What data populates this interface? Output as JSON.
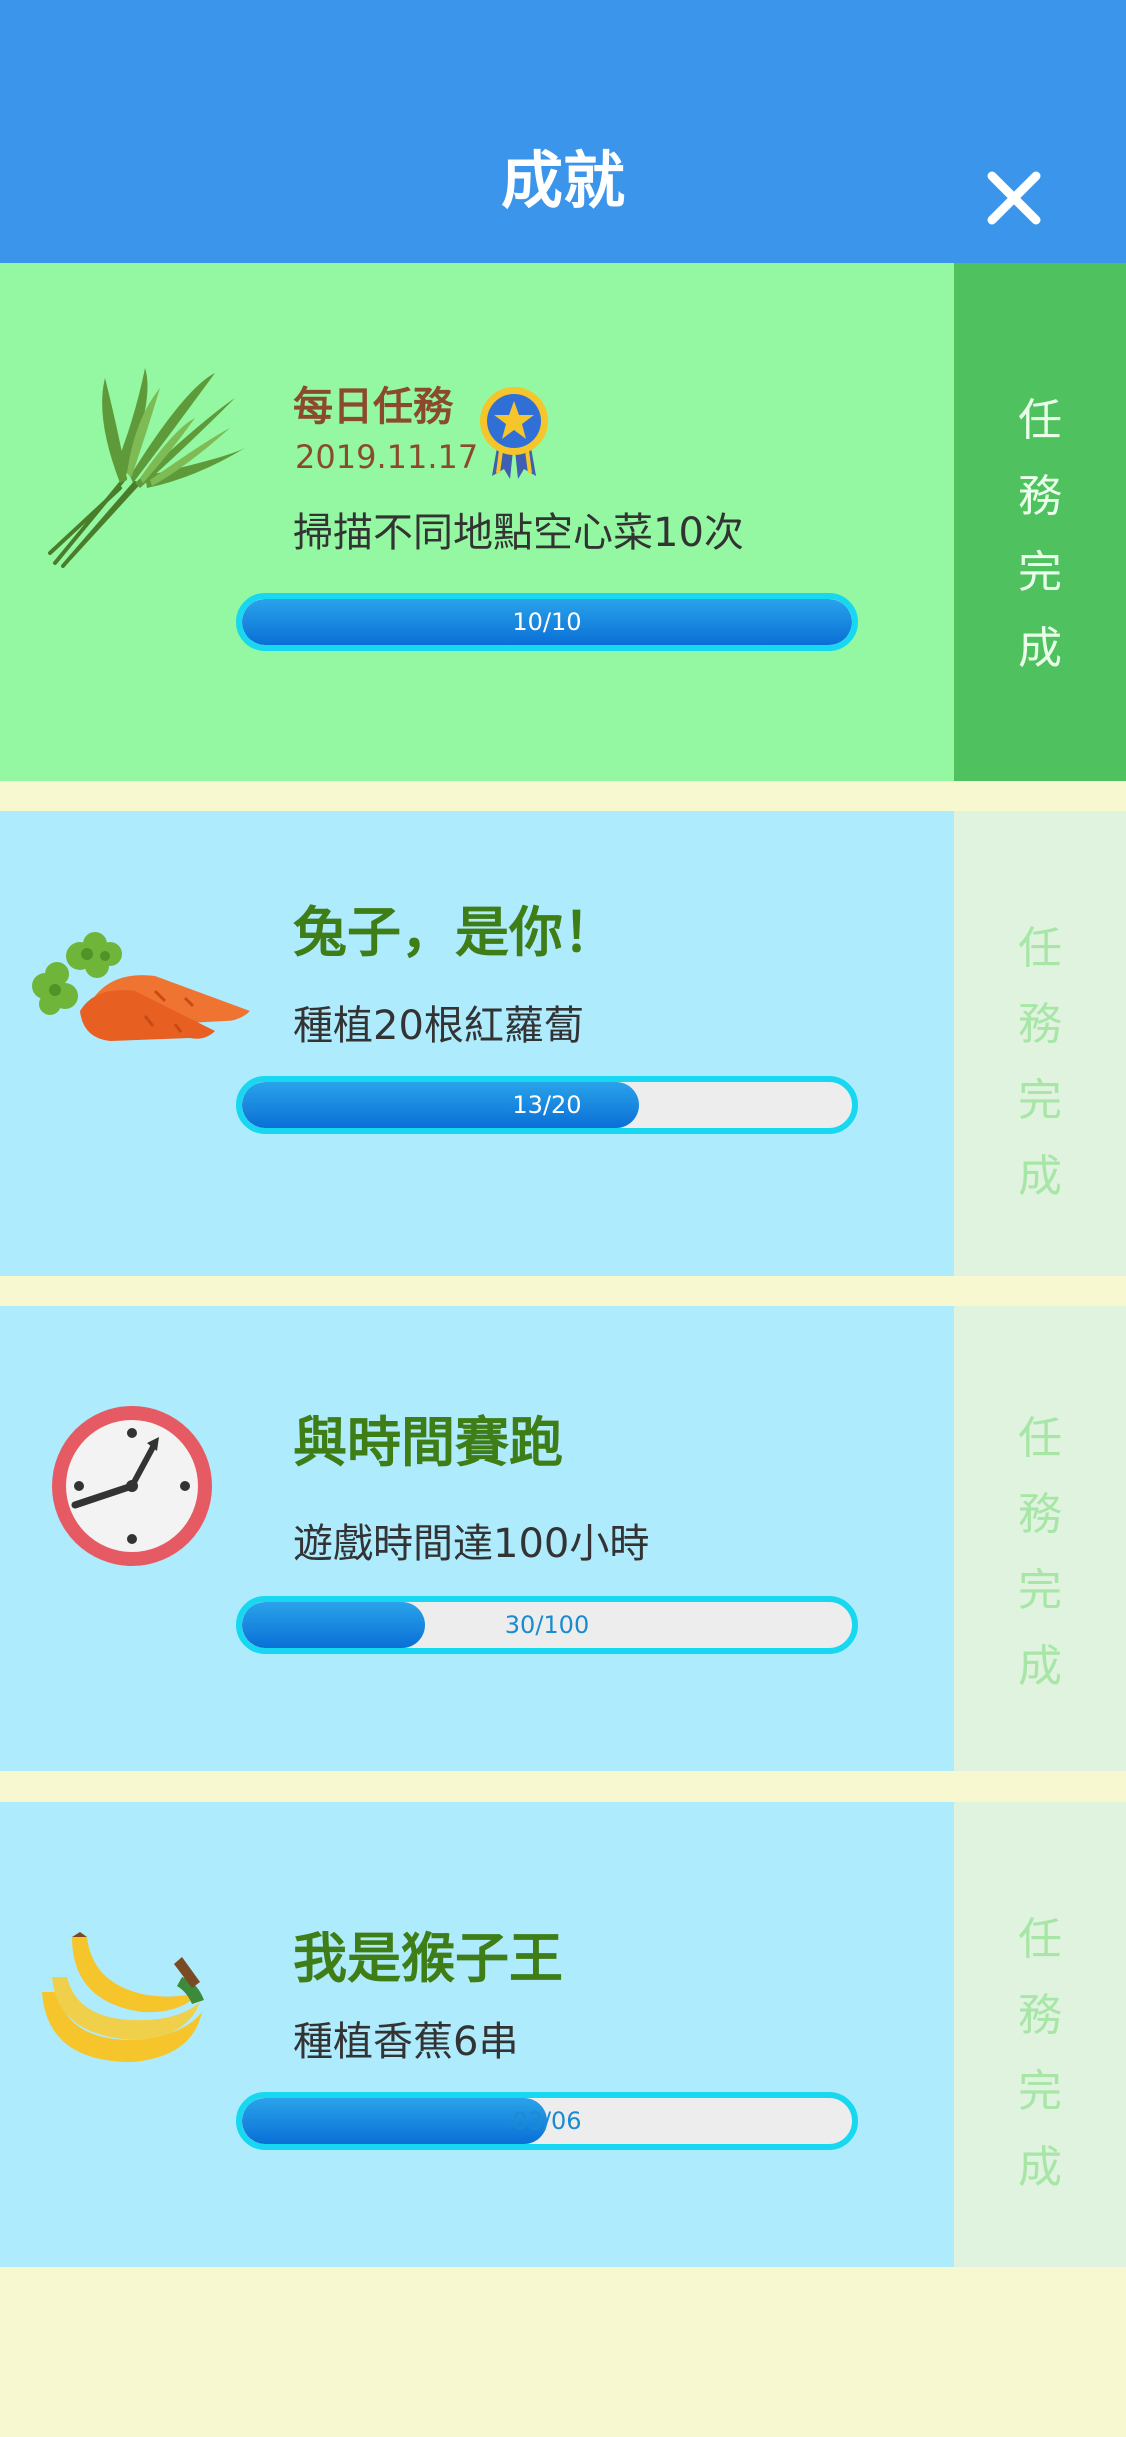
{
  "header": {
    "title": "成就"
  },
  "cards": [
    {
      "type_label": "每日任務",
      "date": "2019.11.17",
      "desc": "掃描不同地點空心菜10次",
      "progress_text": "10/10",
      "progress": 1.0,
      "side_chars": [
        "任",
        "務",
        "完",
        "成"
      ],
      "completed": true
    },
    {
      "title": "兔子，是你！",
      "desc": "種植20根紅蘿蔔",
      "progress_text": "13/20",
      "progress": 0.65,
      "side_chars": [
        "任",
        "務",
        "完",
        "成"
      ],
      "completed": false
    },
    {
      "title": "與時間賽跑",
      "desc": "遊戲時間達100小時",
      "progress_text": "30/100",
      "progress": 0.3,
      "side_chars": [
        "任",
        "務",
        "完",
        "成"
      ],
      "completed": false
    },
    {
      "title": "我是猴子王",
      "desc": "種植香蕉6串",
      "progress_text": "03/06",
      "progress": 0.5,
      "side_chars": [
        "任",
        "務",
        "完",
        "成"
      ],
      "completed": false
    }
  ],
  "colors": {
    "header_bg": "#3b95ea",
    "completed_card_bg": "#93f8a1",
    "completed_side_bg": "#4fc15f",
    "card_bg": "#aeebfd",
    "side_bg": "#dff3df",
    "side_text_inactive": "#a8e6a8",
    "title_green": "#3f7d17",
    "daily_brown": "#8b4a2b"
  }
}
